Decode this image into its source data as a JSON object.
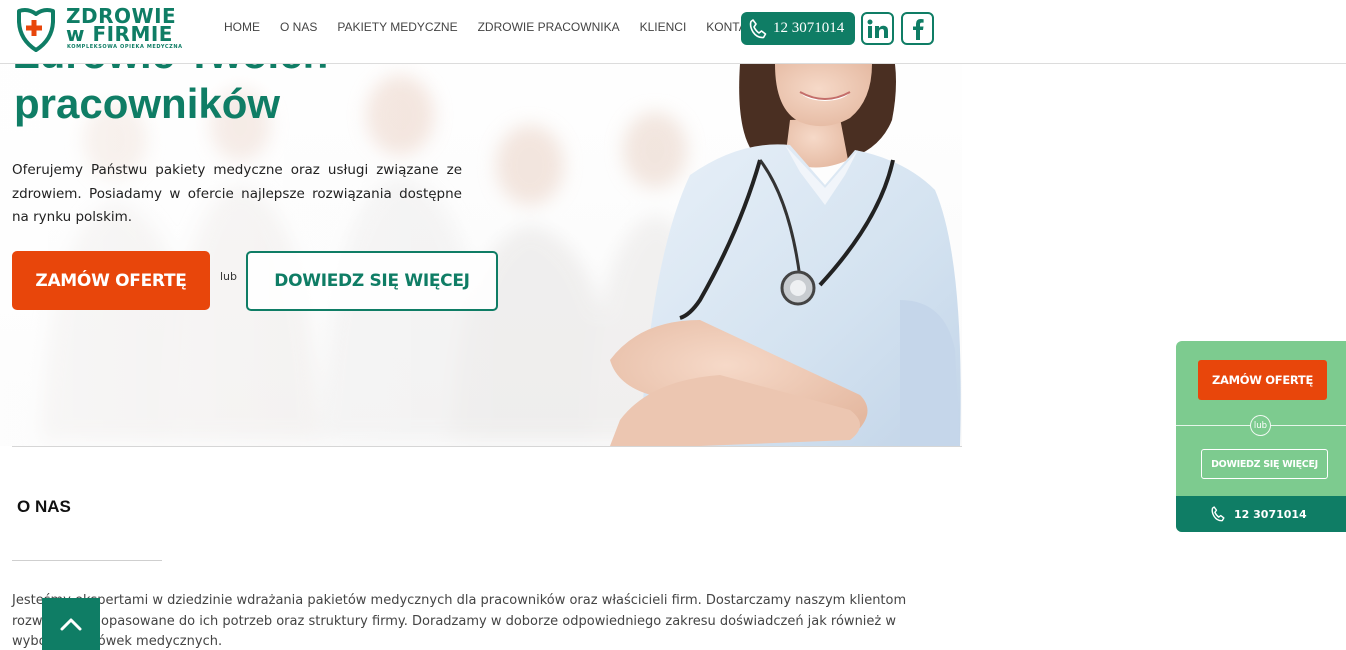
{
  "logo": {
    "word1": "ZDROWIE",
    "word2": "w FIRMIE",
    "tagline": "KOMPLEKSOWA OPIEKA MEDYCZNA"
  },
  "nav": {
    "items": [
      {
        "label": "HOME"
      },
      {
        "label": "O NAS"
      },
      {
        "label": "PAKIETY MEDYCZNE"
      },
      {
        "label": "ZDROWIE PRACOWNIKA"
      },
      {
        "label": "KLIENCI"
      },
      {
        "label": "KONTAKT"
      }
    ]
  },
  "header": {
    "phone": "12 3071014",
    "linkedin_icon": "linkedin-icon",
    "facebook_icon": "facebook-icon"
  },
  "hero": {
    "title_top": "Zdrowie Twoich",
    "title": "pracowników",
    "description": "Oferujemy Państwu pakiety medyczne oraz usługi związane ze zdrowiem. Posiadamy w ofercie najlepsze rozwiązania dostępne na rynku polskim.",
    "order_button": "ZAMÓW OFERTĘ",
    "or_label": "lub",
    "more_button": "DOWIEDZ SIĘ WIĘCEJ"
  },
  "about": {
    "title": "O NAS",
    "text": "Jesteśmy ekspertami w dziedzinie wdrażania pakietów medycznych dla pracowników oraz właścicieli firm. Dostarczamy naszym klientom rozwiązania dopasowane do ich potrzeb oraz struktury firmy. Doradzamy w doborze odpowiedniego zakresu doświadczeń jak również w wyborze placówek medycznych."
  },
  "side_widget": {
    "order_button": "ZAMÓW OFERTĘ",
    "or_label": "lub",
    "more_button": "DOWIEDZ SIĘ WIĘCEJ",
    "phone": "12 3071014"
  },
  "colors": {
    "brand_green": "#0f7d65",
    "accent_orange": "#e8460b",
    "widget_green": "#7dcb8f"
  },
  "icons": {
    "back_to_top": "chevron-up-icon",
    "phone": "phone-icon"
  }
}
